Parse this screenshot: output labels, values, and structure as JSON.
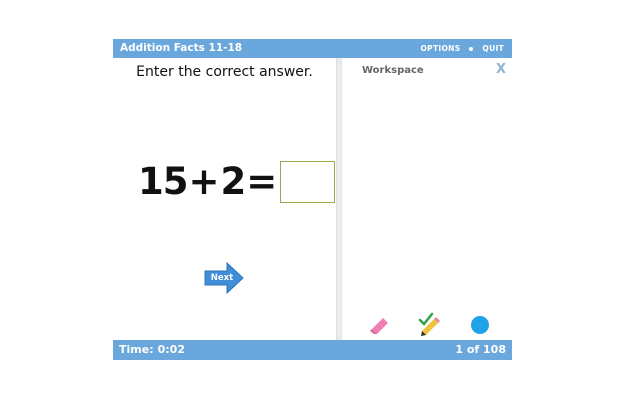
{
  "header": {
    "title": "Addition Facts 11-18",
    "options_label": "OPTIONS",
    "quit_label": "QUIT"
  },
  "problem": {
    "instruction": "Enter the correct answer.",
    "operand1": "15",
    "operator": "+",
    "operand2": "2",
    "equals": "=",
    "answer": ""
  },
  "next_label": "Next",
  "workspace": {
    "title": "Workspace",
    "close_symbol": "X",
    "tools": [
      "eraser-icon",
      "pencil-check-icon",
      "color-circle-icon"
    ]
  },
  "footer": {
    "time_label": "Time:",
    "time_value": "0:02",
    "progress": "1 of 108"
  },
  "colors": {
    "bar": "#6aa7dd",
    "answer_border": "#9aa94a",
    "next_button": "#3f8fd8",
    "eraser": "#f07fb4",
    "pencil": "#f2c33e",
    "check": "#2fa34a",
    "color_circle": "#1fa3e8"
  }
}
